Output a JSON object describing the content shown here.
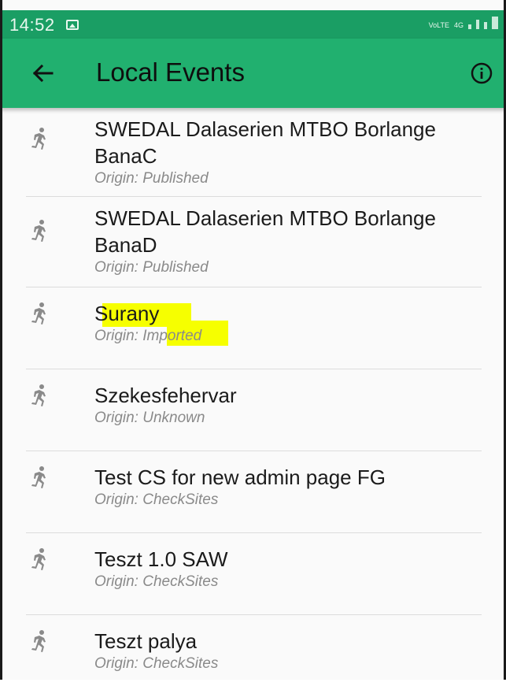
{
  "status_bar": {
    "time": "14:52",
    "network": "4G",
    "network2": "VoLTE"
  },
  "app_bar": {
    "title": "Local Events"
  },
  "events": [
    {
      "name": "SWEDAL Dalaserien MTBO Borlange BanaC",
      "origin": "Origin: Published"
    },
    {
      "name": "SWEDAL Dalaserien MTBO Borlange BanaD",
      "origin": "Origin: Published"
    },
    {
      "name": "Surany",
      "origin": "Origin: Imported",
      "highlight": true
    },
    {
      "name": "Szekesfehervar",
      "origin": "Origin: Unknown"
    },
    {
      "name": "Test CS for new admin page FG",
      "origin": "Origin: CheckSites"
    },
    {
      "name": "Teszt 1.0 SAW",
      "origin": "Origin: CheckSites"
    },
    {
      "name": "Teszt palya",
      "origin": "Origin: CheckSites"
    }
  ],
  "colors": {
    "status_bar": "#1a9e64",
    "app_bar": "#21b06f",
    "highlight": "#f6ff00"
  },
  "icons": {
    "back": "arrow-left-icon",
    "info": "info-icon",
    "event": "runner-icon"
  }
}
